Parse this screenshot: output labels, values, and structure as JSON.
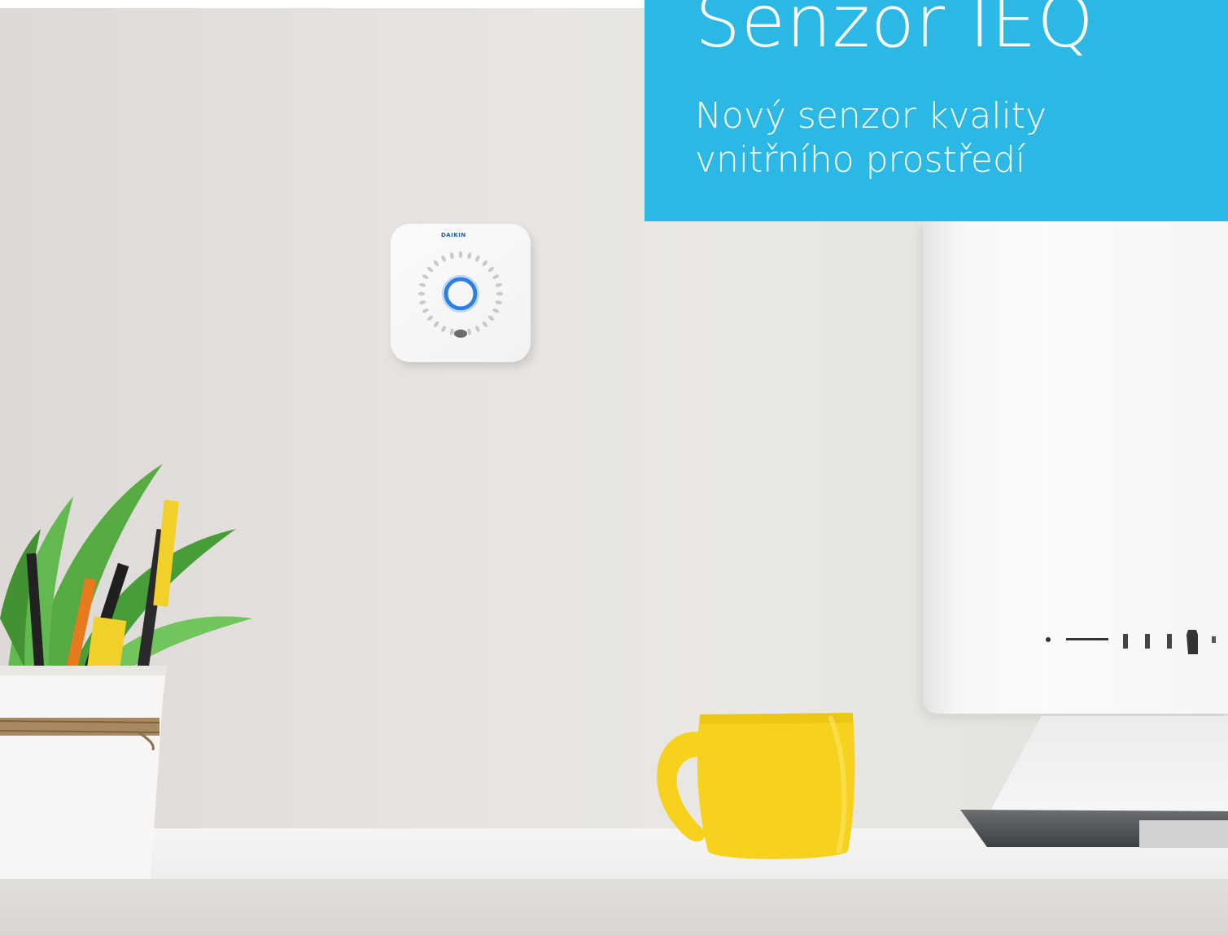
{
  "panel": {
    "title": "Senzor IEQ",
    "subtitle": "Nový senzor kvality vnitřního prostředí",
    "background_color": "#2cb8e5",
    "text_color": "#ffffff"
  },
  "sensor": {
    "brand_text": "DAIKIN",
    "light_color": "#2f7fe0"
  },
  "mug_color": "#f6d21e"
}
